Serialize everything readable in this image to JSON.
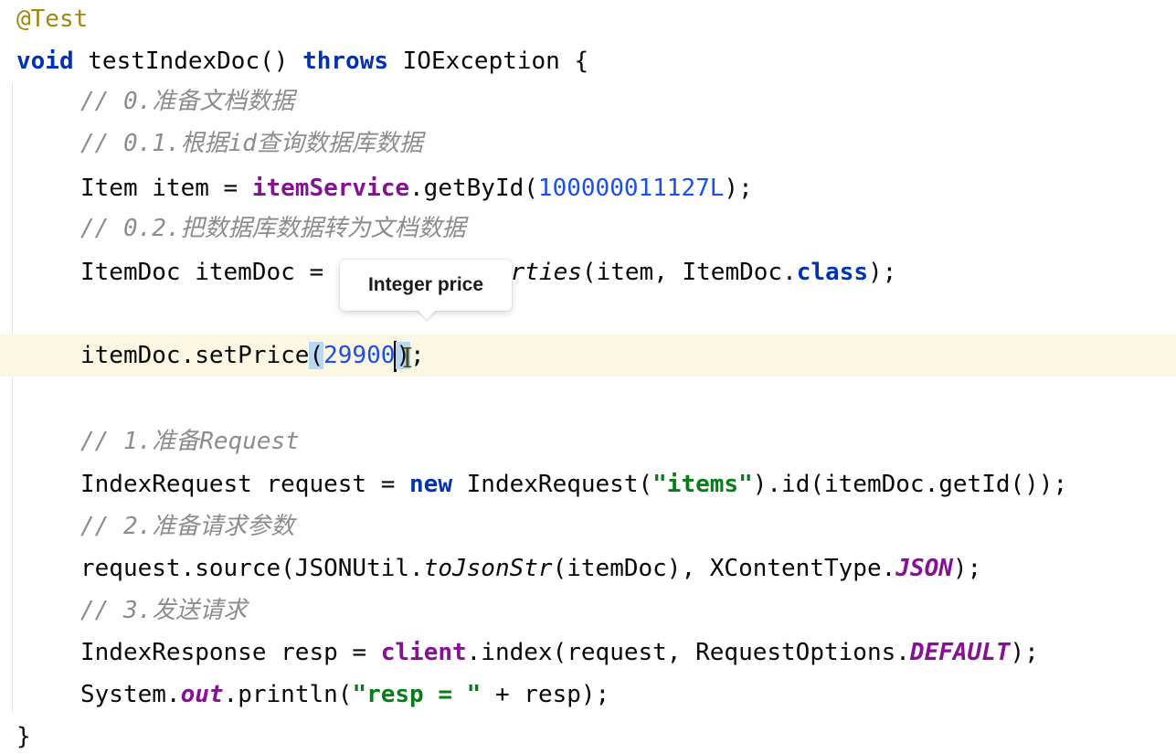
{
  "code": {
    "annotation": "@Test",
    "method_kw": "void",
    "method_sig": " testIndexDoc() ",
    "throws_kw": "throws",
    "method_tail": " IOException {",
    "c_prepare_doc": "// 0.准备文档数据",
    "c_query_db": "// 0.1.根据id查询数据库数据",
    "l_item_a": "Item item = ",
    "l_item_field": "itemService",
    "l_item_b": ".getById(",
    "l_item_num": "100000011127L",
    "l_item_c": ");",
    "c_convert": "// 0.2.把数据库数据转为文档数据",
    "l_doc_a": "ItemDoc itemDoc = ",
    "l_doc_method": "copyProperties",
    "l_doc_b": "(item, ItemDoc.",
    "l_doc_kw": "class",
    "l_doc_c": ");",
    "l_price_a": "itemDoc.setPrice",
    "l_price_open": "(",
    "l_price_num_a": "299",
    "l_price_num_b": "00",
    "l_price_close": ")",
    "l_price_end": ";",
    "c_request": "// 1.准备Request",
    "l_req_a": "IndexRequest request = ",
    "l_req_new": "new",
    "l_req_b": " IndexRequest(",
    "l_req_str": "\"items\"",
    "l_req_c": ").id(itemDoc.getId());",
    "c_params": "// 2.准备请求参数",
    "l_src_a": "request.source(JSONUtil.",
    "l_src_method": "toJsonStr",
    "l_src_b": "(itemDoc), XContentType.",
    "l_src_const": "JSON",
    "l_src_c": ");",
    "c_send": "// 3.发送请求",
    "l_resp_a": "IndexResponse resp = ",
    "l_resp_field": "client",
    "l_resp_b": ".index(request, RequestOptions.",
    "l_resp_const": "DEFAULT",
    "l_resp_c": ");",
    "l_print_a": "System.",
    "l_print_field": "out",
    "l_print_b": ".println(",
    "l_print_str": "\"resp = \"",
    "l_print_c": " + resp);",
    "close_brace": "}"
  },
  "tooltip": {
    "text": "Integer price"
  },
  "colors": {
    "keyword": "#0033b3",
    "field": "#871094",
    "number": "#1750eb",
    "string": "#067d17",
    "comment": "#8c8c8c",
    "annotation": "#9e880d",
    "current_line": "#fcf7e3",
    "param_highlight": "#b8d7f5"
  }
}
